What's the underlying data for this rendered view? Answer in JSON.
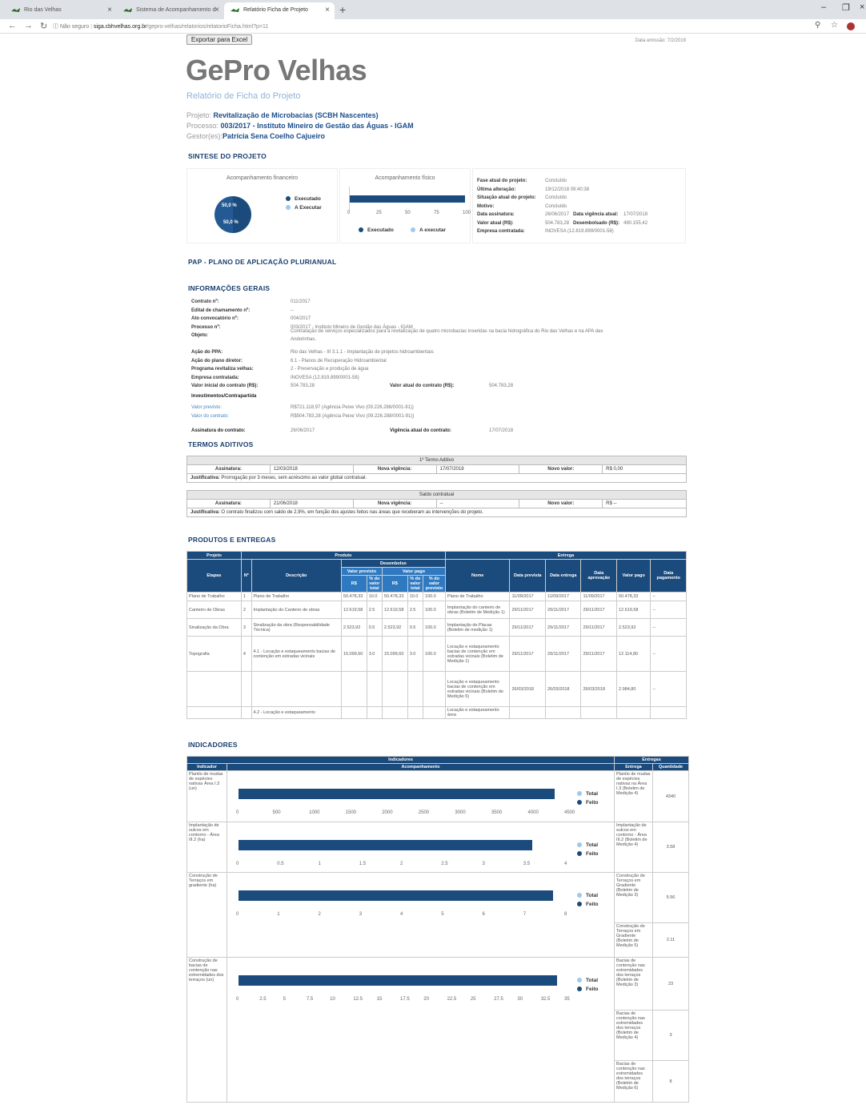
{
  "browser": {
    "tabs": [
      {
        "title": "Rio das Velhas"
      },
      {
        "title": "Sistema de Acompanhamento d"
      },
      {
        "title": "Relatório Ficha de Projeto"
      }
    ],
    "url_not_secure": "Não seguro",
    "url_host": "siga.cbhvelhas.org.br",
    "url_path": "/gepro-velhas/relatorios/relatorioFicha.html?p=11"
  },
  "toolbar": {
    "export_label": "Exportar para Excel",
    "exec_date": "Data emissão: 7/2/2019"
  },
  "header": {
    "title": "GePro Velhas",
    "subtitle": "Relatório de Ficha do Projeto",
    "projeto_label": "Projeto:",
    "projeto_value": "Revitalização de Microbacias (SCBH Nascentes)",
    "processo_label": "Processo:",
    "processo_value": "003/2017 - Instituto Mineiro de Gestão das Águas - IGAM",
    "gestor_label": "Gestor(es):",
    "gestor_value": "Patrícia Sena Coelho Cajueiro"
  },
  "sintese": {
    "title": "SINTESE DO PROJETO",
    "fin_title": "Acompanhamento financeiro",
    "fin_slice_a": "50,0 %",
    "fin_slice_b": "50,0 %",
    "fin_executed_fraction": 0.5,
    "fin_legend_a": "Executado",
    "fin_legend_b": "A Executar",
    "fis_title": "Acompanhamento físico",
    "fis_ticks": [
      "0",
      "25",
      "50",
      "75",
      "100"
    ],
    "fis_executed_value": 100,
    "fis_legend_a": "Executado",
    "fis_legend_b": "A executar",
    "info": [
      {
        "k": "Fase atual do projeto:",
        "v": "Concluído"
      },
      {
        "k": "Última alteração:",
        "v": "19/12/2018 09:40:38"
      },
      {
        "k": "Situação atual do projeto:",
        "v": "Concluído"
      },
      {
        "k": "Motivo:",
        "v": "Concluído"
      },
      {
        "k": "Data assinatura:",
        "v": "26/06/2017",
        "k2": "Data vigência atual:",
        "v2": "17/07/2018"
      },
      {
        "k": "Valor atual (R$):",
        "v": "504.783,28",
        "k2": "Desembolsado (R$):",
        "v2": "490.155,42"
      },
      {
        "k": "Empresa contratada:",
        "v": "INOVESA (12.819.899/0001-58)"
      }
    ]
  },
  "pap": {
    "title": "PAP - PLANO DE APLICAÇÃO PLURIANUAL"
  },
  "geral": {
    "title": "INFORMAÇÕES GERAIS",
    "rows": [
      {
        "k": "Contrato nº:",
        "v": "011/2017"
      },
      {
        "k": "Edital de chamamento nº:",
        "v": "--"
      },
      {
        "k": "Ato convocatório nº:",
        "v": "004/2017"
      },
      {
        "k": "Processo nº:",
        "v": "003/2017 - Instituto Mineiro de Gestão das Águas - IGAM"
      },
      {
        "k": "Objeto:",
        "v": "Contratação de serviços especializados para a revitalização de quatro microbacias inseridas na bacia hidrográfica do Rio das Velhas e na APA das",
        "v_line2": "Andorinhas."
      },
      {
        "k": "Ação do PPA:",
        "v": "Rio das Velhas - III 3.1.1 - Implantação de projetos hidroambientais"
      },
      {
        "k": "Ação do plano diretor:",
        "v": "6.1 - Planos de Recuperação Hidroambiental"
      },
      {
        "k": "Programa revitaliza velhas:",
        "v": "2 - Preservação e produção de água"
      },
      {
        "k": "Empresa contratada:",
        "v": "INOVESA (12.819.899/0001-58)"
      },
      {
        "k": "Valor inicial do contrato (R$):",
        "v": "504.783,28",
        "k2": "Valor atual do contrato (R$):",
        "v2": "504.783,28"
      }
    ],
    "invest_label": "Investimentos/Contrapartida",
    "valor_previsto_label": "Valor previsto:",
    "valor_previsto_value": "R$721.118,97 (Agência Peixe Vivo (09.226.288/0001-91))",
    "valor_contrato_label": "Valor do contrato:",
    "valor_contrato_value": "R$504.783,28 (Agência Peixe Vivo (09.226.288/0001-91))",
    "assinatura_label": "Assinatura do contrato:",
    "assinatura_value": "26/06/2017",
    "vigencia_label": "Vigência atual do contrato:",
    "vigencia_value": "17/07/2018"
  },
  "termos": {
    "title": "TERMOS ADITIVOS",
    "blocks": [
      {
        "header": "1º Termo Aditivo",
        "assinatura_label": "Assinatura:",
        "assinatura": "12/03/2018",
        "vig_label": "Nova vigência:",
        "vig": "17/07/2018",
        "valor_label": "Novo valor:",
        "valor": "R$ 0,00",
        "just_label": "Justificativa:",
        "just": "Prorrogação por 3 meses, sem acréscimo ao valor global contratual."
      },
      {
        "header": "Saldo contratual",
        "assinatura_label": "Assinatura:",
        "assinatura": "21/06/2018",
        "vig_label": "Nova vigência:",
        "vig": "--",
        "valor_label": "Novo valor:",
        "valor": "R$ --",
        "just_label": "Justificativa:",
        "just": "O contrato finalizou com saldo de 2,9%, em função dos ajustes feitos nas áreas que receberam as intervenções do projeto."
      }
    ]
  },
  "produtos": {
    "title": "PRODUTOS E ENTREGAS",
    "h_projeto": "Projeto",
    "h_produto": "Produto",
    "h_entrega": "Entrega",
    "h_desembolso": "Desembolso",
    "h_valor_previsto": "Valor previsto",
    "h_valor_pago": "Valor pago",
    "h_etapas": "Etapas",
    "h_num": "Nº",
    "h_descricao": "Descrição",
    "h_rs": "R$",
    "h_pct": "% do valor total",
    "h_rs2": "R$",
    "h_pct2": "% do valor total",
    "h_pct_prev": "% do valor previsto",
    "h_nome": "Nome",
    "h_data_prevista": "Data prevista",
    "h_data_entrega": "Data entrega",
    "h_data_aprovacao": "Data aprovação",
    "h_valor_pago_e": "Valor pago",
    "h_data_pagamento": "Data pagamento",
    "rows": [
      {
        "etapa": "Plano de Trabalho",
        "n": "1",
        "desc": "Plano de Trabalho",
        "rs": "50.478,33",
        "pct": "10.0",
        "rs2": "50.478,33",
        "pct2": "10.0",
        "pctp": "100.0",
        "nome": "Plano de Trabalho",
        "dp": "11/09/2017",
        "de": "11/09/2017",
        "da": "11/09/2017",
        "vp": "50.478,33",
        "dpg": "--"
      },
      {
        "etapa": "Canteiro de Obras",
        "n": "2",
        "desc": "Implantação do Canteiro de obras",
        "rs": "12.619,58",
        "pct": "2.5",
        "rs2": "12.619,58",
        "pct2": "2.5",
        "pctp": "100.0",
        "nome": "Implantação do canteiro de obras (Boletim de Medição 1)",
        "dp": "29/11/2017",
        "de": "29/11/2017",
        "da": "29/11/2017",
        "vp": "12.619,58",
        "dpg": "--"
      },
      {
        "etapa": "Sinalização da Obra",
        "n": "3",
        "desc": "Sinalização da obra (Responsabilidade Técnica)",
        "rs": "2.523,92",
        "pct": "0.5",
        "rs2": "2.523,92",
        "pct2": "0.5",
        "pctp": "100.0",
        "nome": "Implantação de Placas (Boletim de medição 1)",
        "dp": "29/11/2017",
        "de": "29/11/2017",
        "da": "29/11/2017",
        "vp": "2.523,92",
        "dpg": "--"
      },
      {
        "etapa": "Topografia",
        "n": "4",
        "desc": "4.1 - Locação e estaqueamento bacias de contenção em estradas vicinais",
        "rs": "15.099,60",
        "pct": "3.0",
        "rs2": "15.099,60",
        "pct2": "3.0",
        "pctp": "100.0",
        "nome": "Locação e estaqueamento bacias de contenção em estradas vicinais (Boletim de Medição 1)",
        "dp": "29/11/2017",
        "de": "29/11/2017",
        "da": "29/11/2017",
        "vp": "12.114,80",
        "dpg": "--"
      },
      {
        "etapa": "",
        "n": "",
        "desc": "",
        "rs": "",
        "pct": "",
        "rs2": "",
        "pct2": "",
        "pctp": "",
        "nome": "Locação e estaqueamento bacias de contenção em estradas vicinais (Boletim de Medição 5)",
        "dp": "26/03/2018",
        "de": "26/03/2018",
        "da": "26/03/2018",
        "vp": "2.984,80",
        "dpg": "--"
      },
      {
        "etapa": "",
        "n": "",
        "desc": "4.2 - Locação e estaqueamento",
        "rs": "",
        "pct": "",
        "rs2": "",
        "pct2": "",
        "pctp": "",
        "nome": "Locação e estaqueamento área",
        "dp": "",
        "de": "",
        "da": "",
        "vp": "",
        "dpg": ""
      }
    ]
  },
  "indicadores": {
    "title": "INDICADORES",
    "h_indicadores": "Indicadores",
    "h_entregas": "Entregas",
    "h_indicador": "Indicador",
    "h_acompanhamento": "Acompanhamento",
    "h_entrega": "Entrega",
    "h_quantidade": "Quantidade",
    "legend_total": "Total",
    "legend_feito": "Feito",
    "rows": [
      {
        "label": "Plantio de mudas de espécies nativas Área I.3 (un)",
        "total": 4340,
        "feito": 4340,
        "ticks": [
          "0",
          "500",
          "1000",
          "1500",
          "2000",
          "2500",
          "3000",
          "3500",
          "4000",
          "4500"
        ],
        "max": 4500,
        "entregas": [
          {
            "entrega": "Plantio de mudas de espécies nativas na Área I.3 (Boletim de Medição 4)",
            "qtd": "4340"
          }
        ]
      },
      {
        "label": "Implantação de sulcos em contorno - Área III.2 (ha)",
        "total": 3.58,
        "feito": 3.58,
        "ticks": [
          "0",
          "0.5",
          "1",
          "1.5",
          "2",
          "2.5",
          "3",
          "3.5",
          "4"
        ],
        "max": 4,
        "entregas": [
          {
            "entrega": "Implantação de sulcos em contorno - Área III.2 (Boletim de Medição 4)",
            "qtd": "3.58"
          }
        ]
      },
      {
        "label": "Construção de Terraços em gradiente (ha)",
        "total": 7.67,
        "feito": 7.67,
        "ticks": [
          "0",
          "1",
          "2",
          "3",
          "4",
          "5",
          "6",
          "7",
          "8"
        ],
        "max": 8,
        "entregas": [
          {
            "entrega": "Construção de Terraços em Gradiente (Boletim de Medição 3)",
            "qtd": "5.56"
          },
          {
            "entrega": "Construção de Terraços em Gradiente (Boletim de Medição 5)",
            "qtd": "2.11"
          }
        ]
      },
      {
        "label": "Construção de bacias de contenção nas extremidades dos terraços (un)",
        "total": 34,
        "feito": 34,
        "ticks": [
          "0",
          "2.5",
          "5",
          "7.5",
          "10",
          "12.5",
          "15",
          "17.5",
          "20",
          "22.5",
          "25",
          "27.5",
          "30",
          "32.5",
          "35"
        ],
        "max": 35,
        "entregas": [
          {
            "entrega": "Bacias de contenção nas extremidades dos terraços (Boletim de Medição 3)",
            "qtd": "23"
          },
          {
            "entrega": "Bacias de contenção nas extremidades dos terraços (Boletim de Medição 4)",
            "qtd": "3"
          },
          {
            "entrega": "Bacias de contenção nas extremidades dos terraços (Boletim de Medição 6)",
            "qtd": "8"
          }
        ]
      }
    ]
  },
  "colors": {
    "accent": "#1b4b7c",
    "light": "#9ec9ef",
    "title_gray": "#777777",
    "link": "#1a4d8c"
  }
}
